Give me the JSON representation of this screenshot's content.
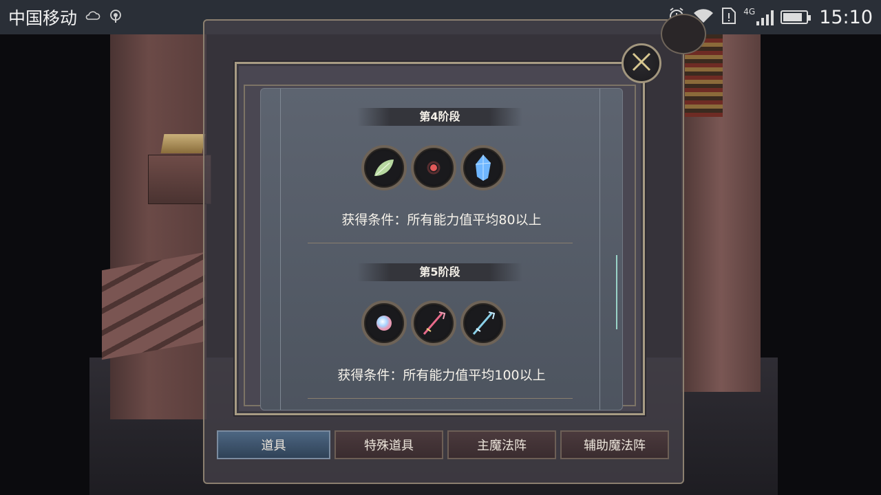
{
  "status_bar": {
    "carrier": "中国移动",
    "network": "4G",
    "time": "15:10",
    "signal_bars": 4,
    "battery_level": 0.85
  },
  "icons": {
    "weather": "cloud-sun-icon",
    "hotspot": "hotspot-icon",
    "alarm": "alarm-icon",
    "wifi": "wifi-icon",
    "sim_alert": "sim-alert-icon"
  },
  "stages": [
    {
      "label": "第4阶段",
      "items": [
        "leaf-item-icon",
        "red-orb-item-icon",
        "blue-crystal-item-icon"
      ],
      "condition": "获得条件：所有能力值平均80以上"
    },
    {
      "label": "第5阶段",
      "items": [
        "pearl-orb-item-icon",
        "red-sword-item-icon",
        "blue-sword-item-icon"
      ],
      "condition": "获得条件：所有能力值平均100以上"
    }
  ],
  "tabs": [
    {
      "label": "道具",
      "active": true
    },
    {
      "label": "特殊道具",
      "active": false
    },
    {
      "label": "主魔法阵",
      "active": false
    },
    {
      "label": "辅助魔法阵",
      "active": false
    }
  ],
  "colors": {
    "accent_frame": "#a89c84",
    "active_tab": "#4d6682",
    "panel": "#5d6470"
  }
}
